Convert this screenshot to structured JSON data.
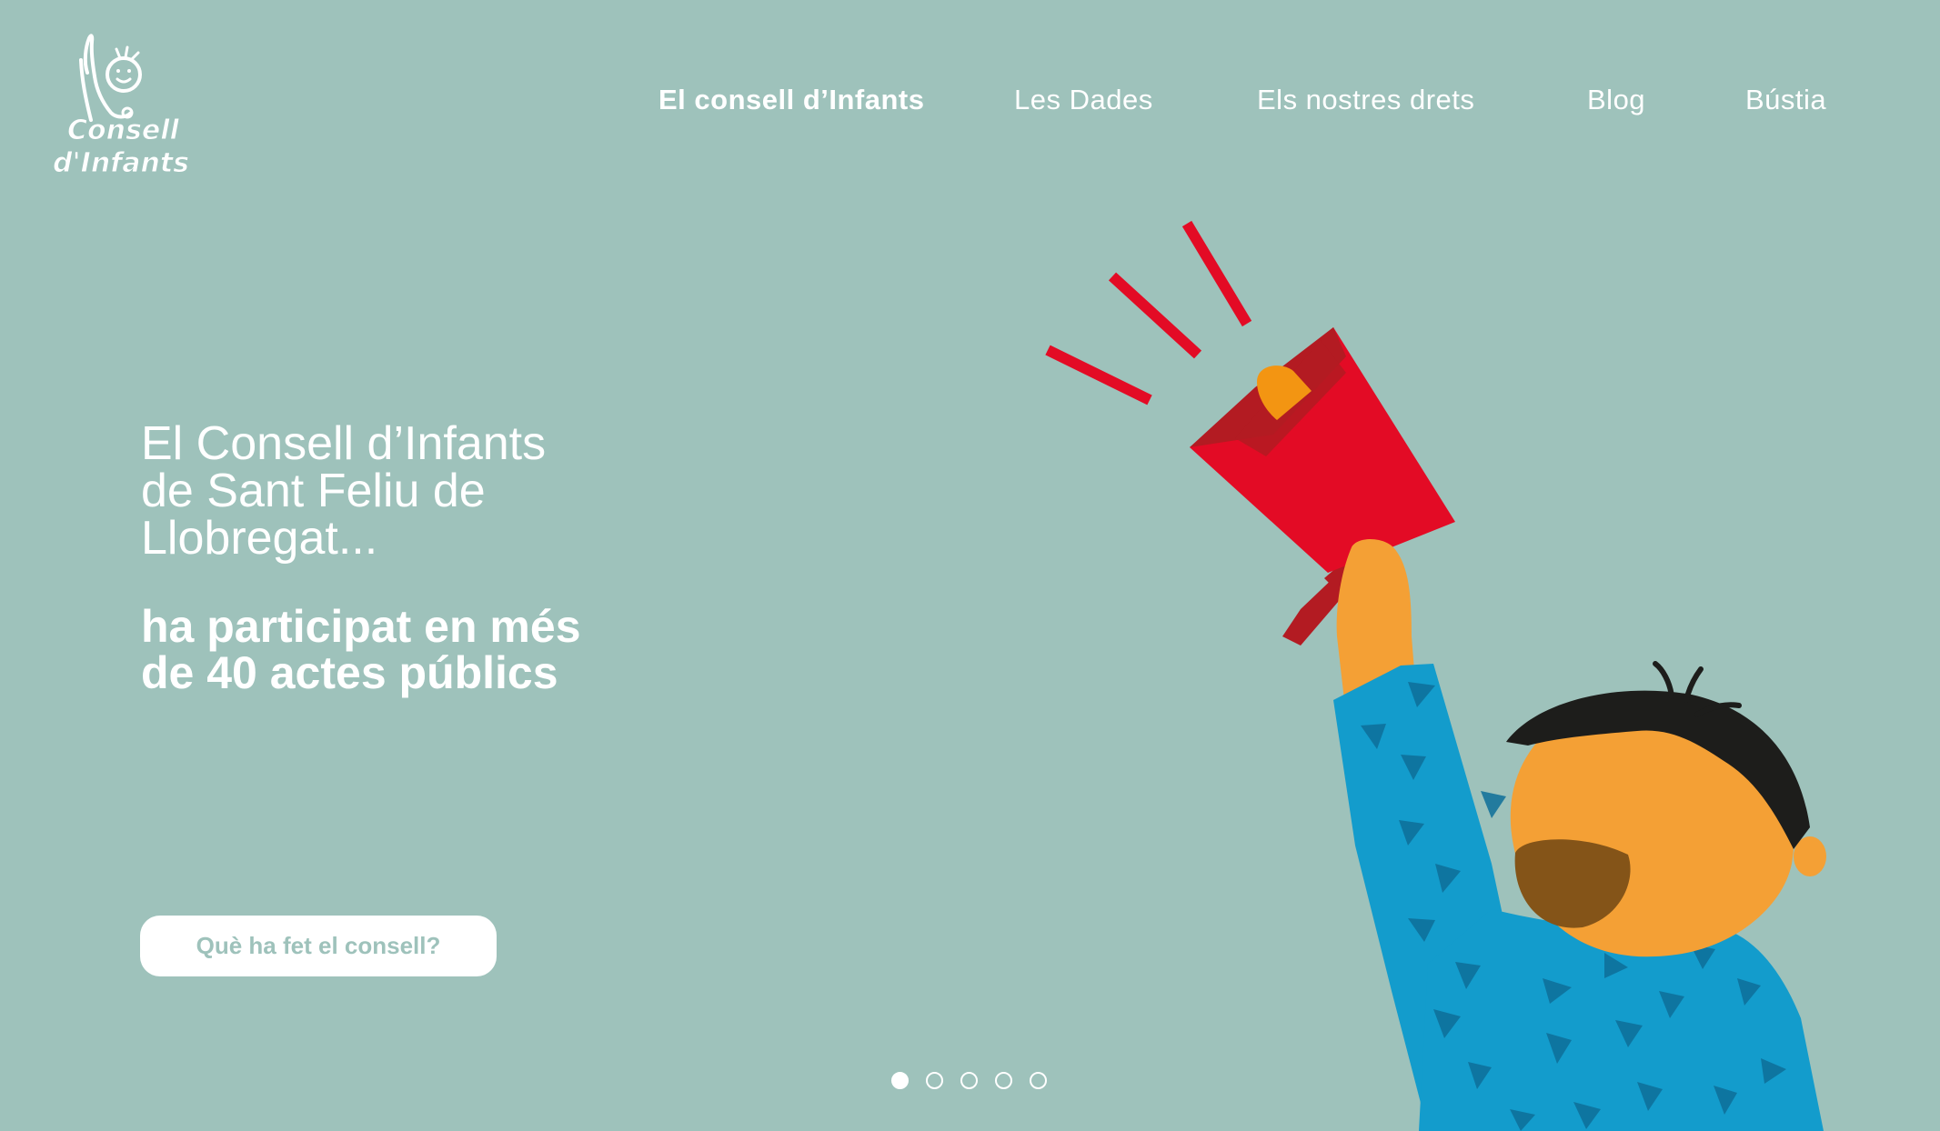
{
  "logo": {
    "line1": "Consell",
    "line2": "d'Infants"
  },
  "nav": {
    "items": [
      {
        "label": "El consell d’Infants",
        "active": true
      },
      {
        "label": "Les Dades",
        "active": false
      },
      {
        "label": "Els nostres drets",
        "active": false
      },
      {
        "label": "Blog",
        "active": false
      },
      {
        "label": "Bústia",
        "active": false
      }
    ]
  },
  "hero": {
    "title_lines": [
      "El Consell d’Infants",
      "de Sant Feliu de",
      "Llobregat..."
    ],
    "subtitle_lines": [
      "ha participat en més",
      "de 40 actes públics"
    ],
    "cta_label": "Què ha fet el consell?"
  },
  "carousel": {
    "slide_count": 5,
    "active_index": 0
  },
  "colors": {
    "background": "#9ec2bb",
    "text": "#ffffff",
    "megaphone": "#e30b25",
    "megaphone_dark": "#b31b22",
    "skin": "#f4a035",
    "shirt": "#139ccc",
    "hair": "#1d1d1b",
    "mouth": "#845418"
  }
}
